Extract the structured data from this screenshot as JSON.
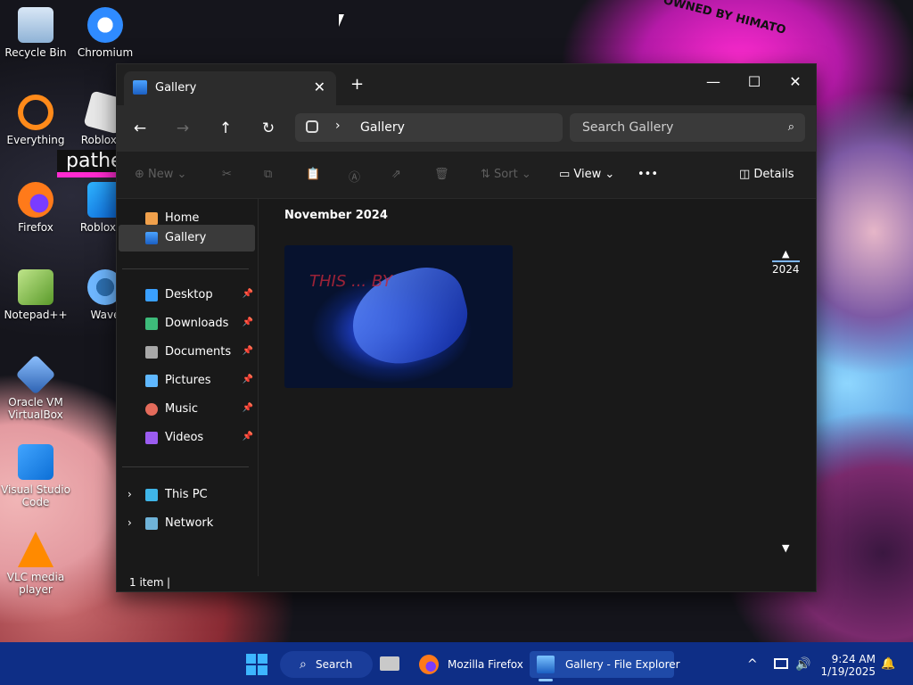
{
  "desktop": {
    "icons": [
      {
        "label": "Recycle Bin"
      },
      {
        "label": "Chromium"
      },
      {
        "label": "Everything"
      },
      {
        "label": "Roblox Pl"
      },
      {
        "label": "Firefox"
      },
      {
        "label": "Roblox St"
      },
      {
        "label": "Notepad++"
      },
      {
        "label": "Wave"
      },
      {
        "label": "Oracle VM VirtualBox"
      },
      {
        "label": "Visual Studio Code"
      },
      {
        "label": "VLC media player"
      }
    ],
    "wallpaper_text": [
      "OWNED BY HIMATO",
      "pathe"
    ]
  },
  "window": {
    "tab_title": "Gallery",
    "tab_close": "✕",
    "new_tab": "+",
    "controls": [
      "—",
      "☐",
      "✕"
    ],
    "nav": {
      "back": "←",
      "forward": "→",
      "up": "↑",
      "refresh": "↻"
    },
    "address": {
      "chevron": "›",
      "location": "Gallery"
    },
    "search": {
      "placeholder": "Search Gallery",
      "icon": "⌕"
    },
    "toolbar": {
      "new_label": "New",
      "sort_label": "Sort",
      "view_label": "View",
      "more_label": "•••",
      "details_label": "Details"
    },
    "sidebar": {
      "home": "Home",
      "gallery": "Gallery",
      "quick": [
        {
          "label": "Desktop",
          "color": "#3aa0ff"
        },
        {
          "label": "Downloads",
          "color": "#3dbb7a"
        },
        {
          "label": "Documents",
          "color": "#a8a8a8"
        },
        {
          "label": "Pictures",
          "color": "#5fb8ff"
        },
        {
          "label": "Music",
          "color": "#e46b5b"
        },
        {
          "label": "Videos",
          "color": "#9b5cf0"
        }
      ],
      "pin": "📌",
      "this_pc": "This PC",
      "network": "Network",
      "expand": "›"
    },
    "content": {
      "group_label": "November 2024",
      "thumb_text": "THIS ... BY",
      "timeline_up": "▲",
      "timeline_year": "2024",
      "timeline_down": "▼"
    },
    "status": {
      "items": "1 item"
    }
  },
  "taskbar": {
    "search_label": "Search",
    "firefox_label": "Mozilla Firefox",
    "explorer_label": "Gallery - File Explorer",
    "time": "9:24 AM",
    "date": "1/19/2025",
    "tray_up": "^",
    "volume": "🔊",
    "bell": "🔔"
  }
}
